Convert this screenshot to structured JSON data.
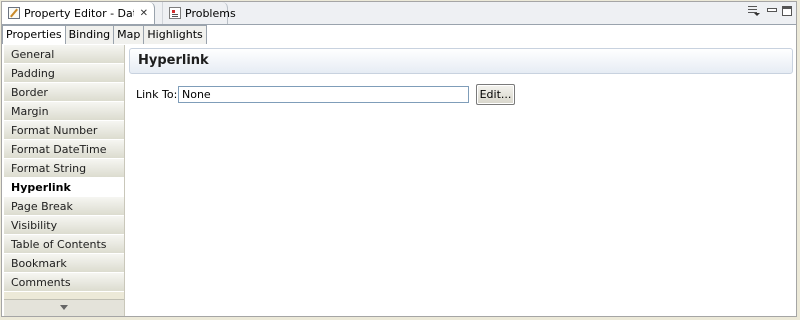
{
  "view_tabs": [
    {
      "label": "Property Editor - Data",
      "icon": "property-editor-icon",
      "closable": true,
      "active": true
    },
    {
      "label": "Problems",
      "icon": "problems-icon",
      "active": false
    }
  ],
  "sub_tabs": [
    "Properties",
    "Binding",
    "Map",
    "Highlights"
  ],
  "nav": {
    "items": [
      "General",
      "Padding",
      "Border",
      "Margin",
      "Format Number",
      "Format DateTime",
      "Format String",
      "Hyperlink",
      "Page Break",
      "Visibility",
      "Table of Contents",
      "Bookmark",
      "Comments"
    ],
    "selected": "Hyperlink"
  },
  "content": {
    "section_title": "Hyperlink",
    "link_to_label": "Link To:",
    "link_to_value": "None",
    "edit_button": "Edit..."
  }
}
